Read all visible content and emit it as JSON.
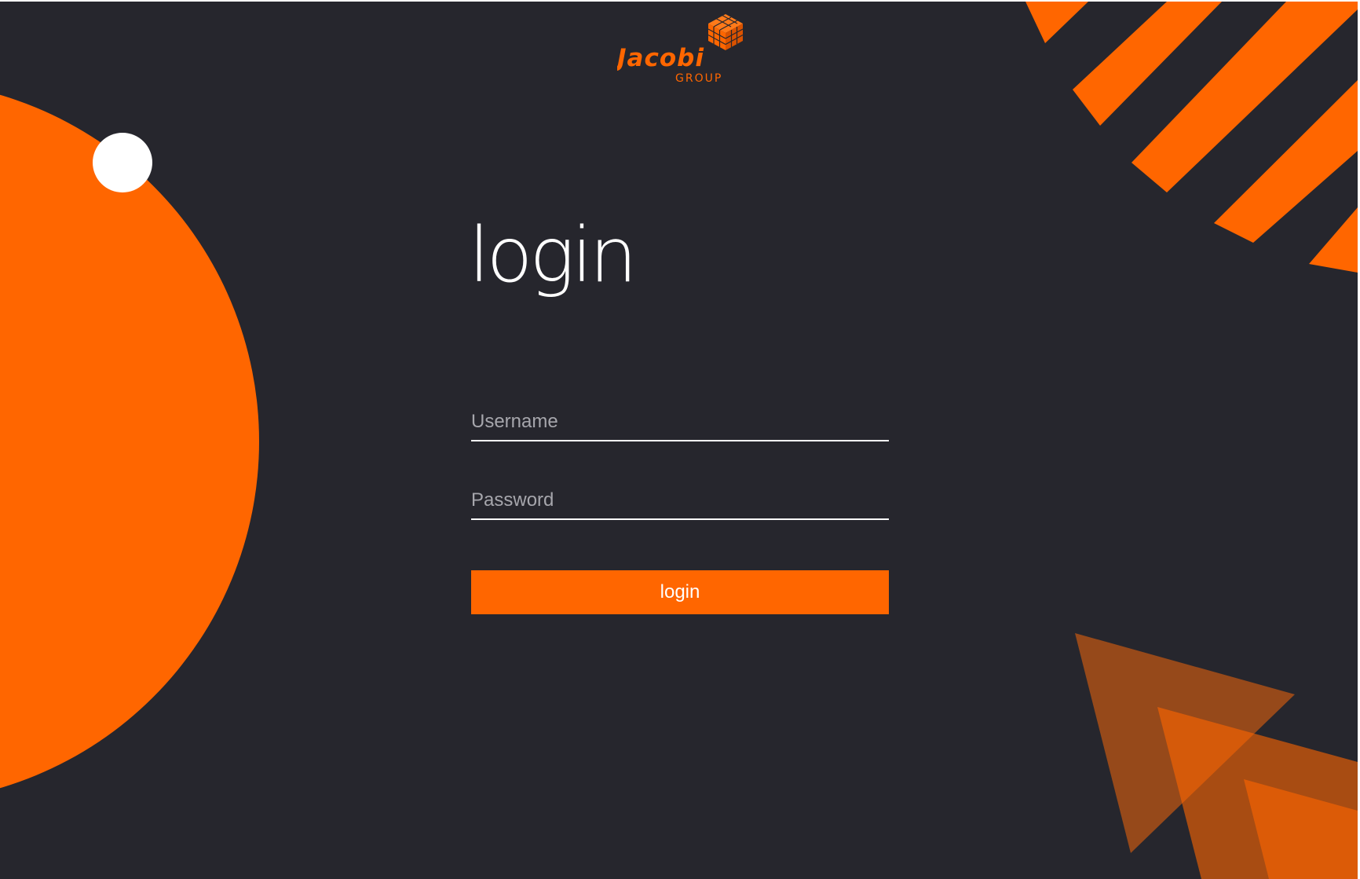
{
  "brand": {
    "name": "Jacobi",
    "sub": "GROUP",
    "logo_icon": "cube-logo-icon"
  },
  "heading": "login",
  "form": {
    "username_placeholder": "Username",
    "password_placeholder": "Password",
    "submit_label": "login"
  },
  "colors": {
    "background": "#26262d",
    "accent": "#ff6600",
    "triangle": "#96491a",
    "text": "#ffffff",
    "placeholder": "#a6a6ac"
  }
}
